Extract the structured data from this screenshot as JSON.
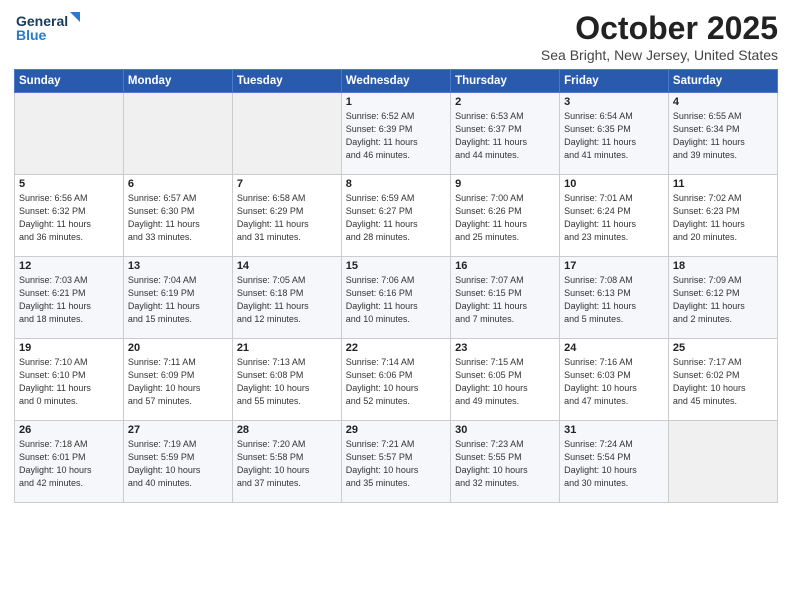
{
  "header": {
    "logo_line1": "General",
    "logo_line2": "Blue",
    "month": "October 2025",
    "location": "Sea Bright, New Jersey, United States"
  },
  "weekdays": [
    "Sunday",
    "Monday",
    "Tuesday",
    "Wednesday",
    "Thursday",
    "Friday",
    "Saturday"
  ],
  "weeks": [
    [
      {
        "day": "",
        "info": ""
      },
      {
        "day": "",
        "info": ""
      },
      {
        "day": "",
        "info": ""
      },
      {
        "day": "1",
        "info": "Sunrise: 6:52 AM\nSunset: 6:39 PM\nDaylight: 11 hours\nand 46 minutes."
      },
      {
        "day": "2",
        "info": "Sunrise: 6:53 AM\nSunset: 6:37 PM\nDaylight: 11 hours\nand 44 minutes."
      },
      {
        "day": "3",
        "info": "Sunrise: 6:54 AM\nSunset: 6:35 PM\nDaylight: 11 hours\nand 41 minutes."
      },
      {
        "day": "4",
        "info": "Sunrise: 6:55 AM\nSunset: 6:34 PM\nDaylight: 11 hours\nand 39 minutes."
      }
    ],
    [
      {
        "day": "5",
        "info": "Sunrise: 6:56 AM\nSunset: 6:32 PM\nDaylight: 11 hours\nand 36 minutes."
      },
      {
        "day": "6",
        "info": "Sunrise: 6:57 AM\nSunset: 6:30 PM\nDaylight: 11 hours\nand 33 minutes."
      },
      {
        "day": "7",
        "info": "Sunrise: 6:58 AM\nSunset: 6:29 PM\nDaylight: 11 hours\nand 31 minutes."
      },
      {
        "day": "8",
        "info": "Sunrise: 6:59 AM\nSunset: 6:27 PM\nDaylight: 11 hours\nand 28 minutes."
      },
      {
        "day": "9",
        "info": "Sunrise: 7:00 AM\nSunset: 6:26 PM\nDaylight: 11 hours\nand 25 minutes."
      },
      {
        "day": "10",
        "info": "Sunrise: 7:01 AM\nSunset: 6:24 PM\nDaylight: 11 hours\nand 23 minutes."
      },
      {
        "day": "11",
        "info": "Sunrise: 7:02 AM\nSunset: 6:23 PM\nDaylight: 11 hours\nand 20 minutes."
      }
    ],
    [
      {
        "day": "12",
        "info": "Sunrise: 7:03 AM\nSunset: 6:21 PM\nDaylight: 11 hours\nand 18 minutes."
      },
      {
        "day": "13",
        "info": "Sunrise: 7:04 AM\nSunset: 6:19 PM\nDaylight: 11 hours\nand 15 minutes."
      },
      {
        "day": "14",
        "info": "Sunrise: 7:05 AM\nSunset: 6:18 PM\nDaylight: 11 hours\nand 12 minutes."
      },
      {
        "day": "15",
        "info": "Sunrise: 7:06 AM\nSunset: 6:16 PM\nDaylight: 11 hours\nand 10 minutes."
      },
      {
        "day": "16",
        "info": "Sunrise: 7:07 AM\nSunset: 6:15 PM\nDaylight: 11 hours\nand 7 minutes."
      },
      {
        "day": "17",
        "info": "Sunrise: 7:08 AM\nSunset: 6:13 PM\nDaylight: 11 hours\nand 5 minutes."
      },
      {
        "day": "18",
        "info": "Sunrise: 7:09 AM\nSunset: 6:12 PM\nDaylight: 11 hours\nand 2 minutes."
      }
    ],
    [
      {
        "day": "19",
        "info": "Sunrise: 7:10 AM\nSunset: 6:10 PM\nDaylight: 11 hours\nand 0 minutes."
      },
      {
        "day": "20",
        "info": "Sunrise: 7:11 AM\nSunset: 6:09 PM\nDaylight: 10 hours\nand 57 minutes."
      },
      {
        "day": "21",
        "info": "Sunrise: 7:13 AM\nSunset: 6:08 PM\nDaylight: 10 hours\nand 55 minutes."
      },
      {
        "day": "22",
        "info": "Sunrise: 7:14 AM\nSunset: 6:06 PM\nDaylight: 10 hours\nand 52 minutes."
      },
      {
        "day": "23",
        "info": "Sunrise: 7:15 AM\nSunset: 6:05 PM\nDaylight: 10 hours\nand 49 minutes."
      },
      {
        "day": "24",
        "info": "Sunrise: 7:16 AM\nSunset: 6:03 PM\nDaylight: 10 hours\nand 47 minutes."
      },
      {
        "day": "25",
        "info": "Sunrise: 7:17 AM\nSunset: 6:02 PM\nDaylight: 10 hours\nand 45 minutes."
      }
    ],
    [
      {
        "day": "26",
        "info": "Sunrise: 7:18 AM\nSunset: 6:01 PM\nDaylight: 10 hours\nand 42 minutes."
      },
      {
        "day": "27",
        "info": "Sunrise: 7:19 AM\nSunset: 5:59 PM\nDaylight: 10 hours\nand 40 minutes."
      },
      {
        "day": "28",
        "info": "Sunrise: 7:20 AM\nSunset: 5:58 PM\nDaylight: 10 hours\nand 37 minutes."
      },
      {
        "day": "29",
        "info": "Sunrise: 7:21 AM\nSunset: 5:57 PM\nDaylight: 10 hours\nand 35 minutes."
      },
      {
        "day": "30",
        "info": "Sunrise: 7:23 AM\nSunset: 5:55 PM\nDaylight: 10 hours\nand 32 minutes."
      },
      {
        "day": "31",
        "info": "Sunrise: 7:24 AM\nSunset: 5:54 PM\nDaylight: 10 hours\nand 30 minutes."
      },
      {
        "day": "",
        "info": ""
      }
    ]
  ]
}
